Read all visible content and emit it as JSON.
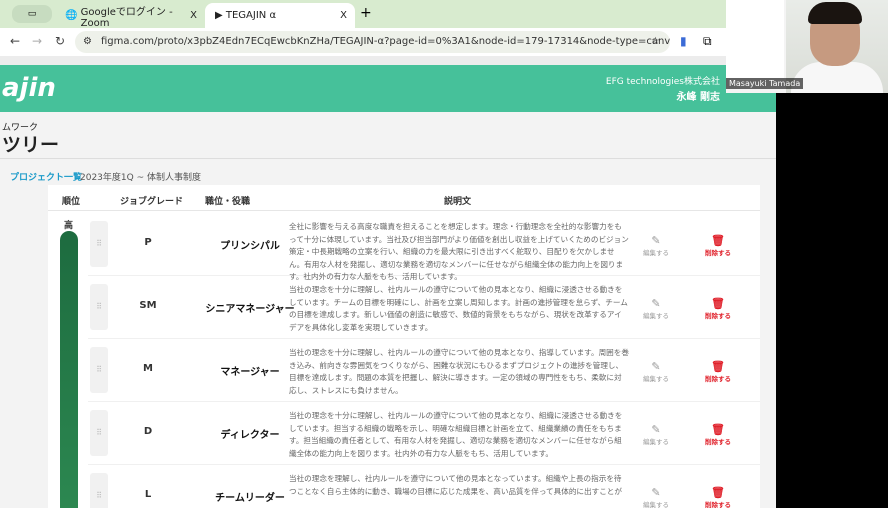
{
  "browser": {
    "tabs": [
      {
        "label": "Googleでログイン - Zoom",
        "close": "X"
      },
      {
        "label": "TEGAJIN α",
        "close": "X"
      }
    ],
    "new_tab": "+",
    "url": "figma.com/proto/x3pbZ4Edn7ECqEwcbKnZHa/TEGAJIN-α?page-id=0%3A1&node-id=179-17314&node-type=canvas&viewport=..."
  },
  "header": {
    "logo": "ajin",
    "company": "EFG technologies株式会社",
    "user": "永峰 剛志"
  },
  "page": {
    "subtitle": "ムワーク",
    "title": "ツリー",
    "breadcrumb": "プロジェクト一覧",
    "breadcrumb_current": "2023年度1Q ~ 体制人事制度"
  },
  "table": {
    "headers": [
      "順位",
      "ジョブグレード",
      "職位・役職",
      "説明文"
    ],
    "rank_top": "高",
    "edit_label": "編集する",
    "delete_label": "削除する",
    "rows": [
      {
        "grade": "P",
        "role": "プリンシパル",
        "desc": "全社に影響を与える高度な職責を担えることを想定します。理念・行動理念を全社的な影響力をもって十分に体現しています。当社及び担当部門がより価値を創出し収益を上げていくためのビジョン策定・中長期戦略の立案を行い、組織の力を最大限に引き出すべく舵取り、目配りを欠かしません。有用な人材を発掘し、適切な業務を適切なメンバーに任せながら組織全体の能力向上を図ります。社内外の有力な人脈をもち、活用しています。"
      },
      {
        "grade": "SM",
        "role": "シニアマネージャー",
        "desc": "当社の理念を十分に理解し、社内ルールの遵守について他の見本となり、組織に浸透させる動きをしています。チームの目標を明確にし、計画を立案し周知します。計画の進捗管理を怠らず、チームの目標を達成します。新しい価値の創造に敏感で、数値的背景をもちながら、現状を改革するアイデアを具体化し変革を実現していきます。"
      },
      {
        "grade": "M",
        "role": "マネージャー",
        "desc": "当社の理念を十分に理解し、社内ルールの遵守について他の見本となり、指導しています。周囲を巻き込み、前向きな雰囲気をつくりながら、困難な状況にもひるまずプロジェクトの進捗を管理し、目標を達成します。問題の本質を把握し、解決に導きます。一定の領域の専門性をもち、柔軟に対応し、ストレスにも負けません。"
      },
      {
        "grade": "D",
        "role": "ディレクター",
        "desc": "当社の理念を十分に理解し、社内ルールの遵守について他の見本となり、組織に浸透させる動きをしています。担当する組織の戦略を示し、明確な組織目標と計画を立て、組織業績の責任をもちます。担当組織の責任者として、有用な人材を発掘し、適切な業務を適切なメンバーに任せながら組織全体の能力向上を図ります。社内外の有力な人脈をもち、活用しています。"
      },
      {
        "grade": "L",
        "role": "チームリーダー",
        "desc": "当社の理念を理解し、社内ルールを遵守について他の見本となっています。組織や上長の指示を待つことなく自ら主体的に動き、職場の目標に応じた成果を、高い品質を伴って具体的に出すことが"
      }
    ]
  },
  "video": {
    "participant": "Masayuki Tamada"
  },
  "colors": {
    "header": "#46c19a",
    "bar": "#1d6b3f",
    "delete": "#e0202a",
    "link": "#1a9ac9"
  }
}
